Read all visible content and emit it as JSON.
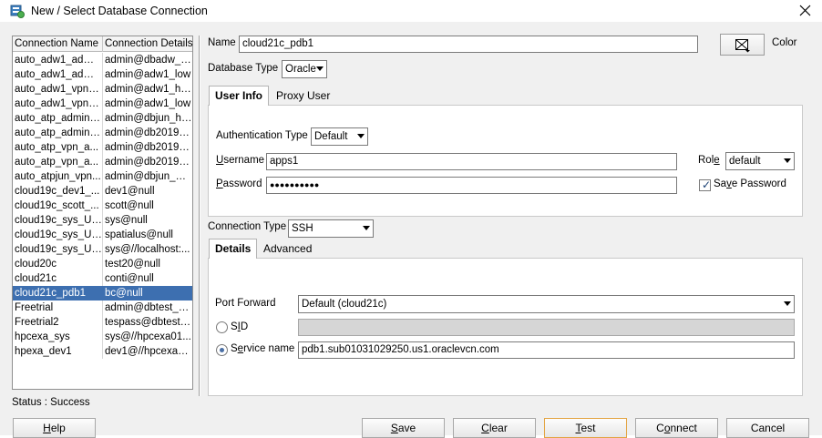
{
  "window": {
    "title": "New / Select Database Connection"
  },
  "list": {
    "columns": [
      "Connection Name",
      "Connection Details"
    ],
    "rows": [
      {
        "name": "auto_adw1_admi...",
        "details": "admin@dbadw_high"
      },
      {
        "name": "auto_adw1_admi...",
        "details": "admin@adw1_low"
      },
      {
        "name": "auto_adw1_vpn_...",
        "details": "admin@adw1_high"
      },
      {
        "name": "auto_adw1_vpn_...",
        "details": "admin@adw1_low"
      },
      {
        "name": "auto_atp_admin_...",
        "details": "admin@dbjun_high"
      },
      {
        "name": "auto_atp_admin_...",
        "details": "admin@db20190..."
      },
      {
        "name": "auto_atp_vpn_a...",
        "details": "admin@db20190..."
      },
      {
        "name": "auto_atp_vpn_a...",
        "details": "admin@db20190..."
      },
      {
        "name": "auto_atpjun_vpn...",
        "details": "admin@dbjun_m..."
      },
      {
        "name": "cloud19c_dev1_...",
        "details": "dev1@null"
      },
      {
        "name": "cloud19c_scott_...",
        "details": "scott@null"
      },
      {
        "name": "cloud19c_sys_US1",
        "details": "sys@null"
      },
      {
        "name": "cloud19c_sys_US...",
        "details": "spatialus@null"
      },
      {
        "name": "cloud19c_sys_US...",
        "details": "sys@//localhost:..."
      },
      {
        "name": "cloud20c",
        "details": "test20@null"
      },
      {
        "name": "cloud21c",
        "details": "conti@null"
      },
      {
        "name": "cloud21c_pdb1",
        "details": "bc@null"
      },
      {
        "name": "Freetrial",
        "details": "admin@dbtest_high"
      },
      {
        "name": "Freetrial2",
        "details": "tespass@dbtest_..."
      },
      {
        "name": "hpcexa_sys",
        "details": "sys@//hpcexa01..."
      },
      {
        "name": "hpexa_dev1",
        "details": "dev1@//hpcexa0..."
      }
    ],
    "selected_index": 16
  },
  "status": "Status : Success",
  "form": {
    "name_label": "Name",
    "name_value": "cloud21c_pdb1",
    "color_label": "Color",
    "db_type_label": "Database Type",
    "db_type_value": "Oracle",
    "tabs": [
      "User Info",
      "Proxy User"
    ],
    "auth_type_label": "Authentication Type",
    "auth_type_value": "Default",
    "username_label_u": "U",
    "username_label_rest": "sername",
    "username_value": "apps1",
    "password_label_u": "P",
    "password_label_rest": "assword",
    "password_value": "●●●●●●●●●●",
    "role_label_pre": "Rol",
    "role_label_u": "e",
    "role_value": "default",
    "save_password_pre": "Sa",
    "save_password_u": "v",
    "save_password_post": "e Password",
    "save_password_checked": true,
    "conn_type_label": "Connection Type",
    "conn_type_value": "SSH",
    "conn_tabs": [
      "Details",
      "Advanced"
    ],
    "port_forward_label": "Port Forward",
    "port_forward_value": "Default (cloud21c)",
    "sid_label_pre": "S",
    "sid_label_u": "I",
    "sid_label_post": "D",
    "sid_value": "",
    "service_label_pre": "S",
    "service_label_u": "e",
    "service_label_post": "rvice name",
    "service_value": "pdb1.sub01031029250.us1.oraclevcn.com",
    "selected_radio": "service"
  },
  "buttons": {
    "help": {
      "u": "H",
      "rest": "elp"
    },
    "save": {
      "u": "S",
      "rest": "ave"
    },
    "clear": {
      "u": "C",
      "rest": "lear"
    },
    "test": {
      "u": "T",
      "rest": "est"
    },
    "connect": {
      "pre": "C",
      "u": "o",
      "rest": "nnect"
    },
    "cancel": {
      "label": "Cancel"
    }
  },
  "colors": {
    "selection": "#3d6fb0",
    "dialog_bg": "#f0f0f0",
    "focus_border": "#e3a443"
  }
}
